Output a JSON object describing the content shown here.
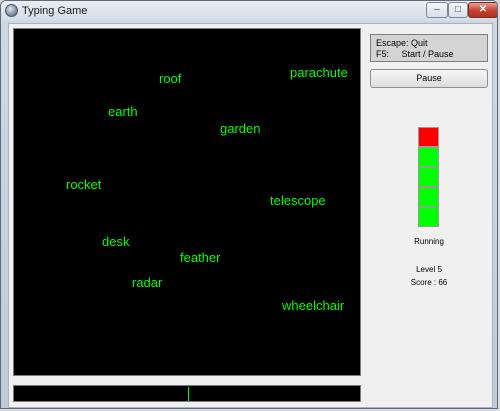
{
  "window": {
    "title": "Typing Game",
    "controls": {
      "minimize": "–",
      "maximize": "□",
      "close": "✕"
    }
  },
  "game": {
    "words": [
      "roof",
      "parachute",
      "earth",
      "garden",
      "rocket",
      "telescope",
      "desk",
      "feather",
      "radar",
      "wheelchair"
    ]
  },
  "help": {
    "line1": "Escape: Quit",
    "line2": "F5:     Start / Pause"
  },
  "pause_button": "Pause",
  "meter": {
    "cells_total": 5,
    "cells_red": 1,
    "red_color": "#ff0000",
    "green_color": "#00ff00"
  },
  "status": "Running",
  "level": "Level 5",
  "score": {
    "label": "Score",
    "separator": " : ",
    "value": "66"
  },
  "colors": {
    "word": "#00ff00",
    "field": "#000000"
  }
}
